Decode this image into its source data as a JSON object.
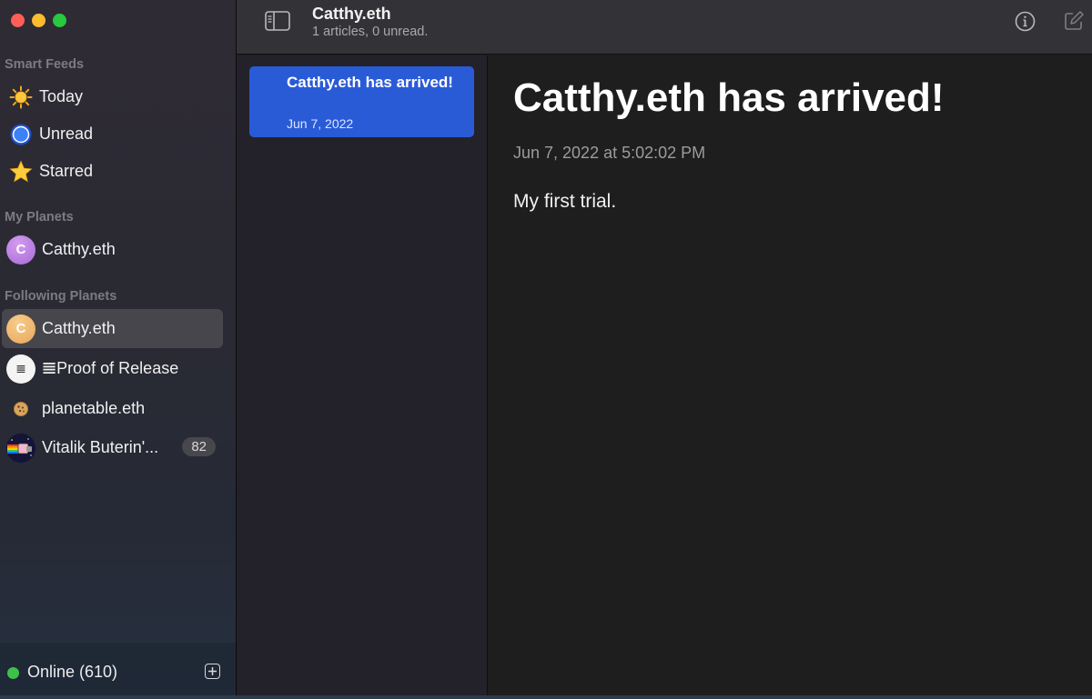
{
  "toolbar": {
    "title": "Catthy.eth",
    "subtitle": "1 articles, 0 unread."
  },
  "sidebar": {
    "smart_feeds_title": "Smart Feeds",
    "smart_feeds": [
      {
        "label": "Today",
        "icon": "sun-icon"
      },
      {
        "label": "Unread",
        "icon": "blue-circle-icon"
      },
      {
        "label": "Starred",
        "icon": "star-icon"
      }
    ],
    "my_planets_title": "My Planets",
    "my_planets": [
      {
        "label": "Catthy.eth",
        "avatar_letter": "C"
      }
    ],
    "following_title": "Following Planets",
    "following": [
      {
        "label": "Catthy.eth",
        "avatar_letter": "C",
        "selected": true
      },
      {
        "label": "𝌆Proof of Release",
        "avatar_letter": "𝌆"
      },
      {
        "label": "planetable.eth",
        "avatar": "cookie-avatar"
      },
      {
        "label": "Vitalik Buterin'...",
        "avatar": "nyan-avatar",
        "badge": "82"
      }
    ],
    "status": {
      "label": "Online (610)",
      "color": "#3ec14a"
    }
  },
  "article_list": [
    {
      "title": "Catthy.eth has arrived!",
      "date": "Jun 7, 2022",
      "selected": true
    }
  ],
  "article": {
    "title": "Catthy.eth has arrived!",
    "date": "Jun 7, 2022 at 5:02:02 PM",
    "body": "My first trial."
  },
  "colors": {
    "accent": "#2a5bd7",
    "online": "#3ec14a"
  }
}
